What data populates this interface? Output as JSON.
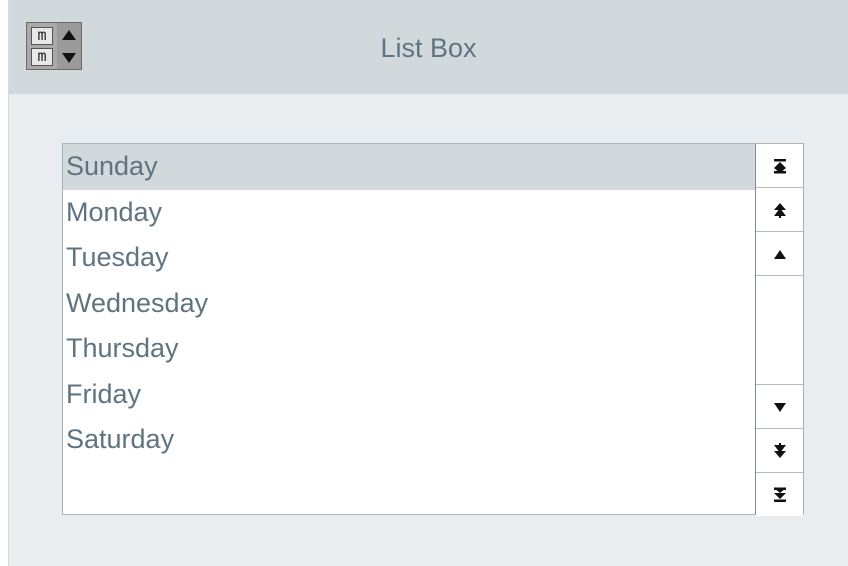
{
  "window": {
    "title": "List Box"
  },
  "app_icon": {
    "letters": [
      "m",
      "m"
    ]
  },
  "listbox": {
    "items": [
      "Sunday",
      "Monday",
      "Tuesday",
      "Wednesday",
      "Thursday",
      "Friday",
      "Saturday"
    ],
    "selected_item": "Sunday",
    "scrollbar_buttons": [
      "scroll-to-top-icon",
      "page-up-icon",
      "line-up-icon",
      "line-down-icon",
      "page-down-icon",
      "scroll-to-bottom-icon"
    ]
  },
  "colors": {
    "titlebar_bg": "#d2d9dd",
    "window_bg": "#e9edf0",
    "text": "#5f7480",
    "selected_bg": "#d2d9dd"
  }
}
